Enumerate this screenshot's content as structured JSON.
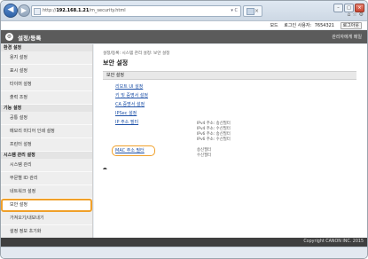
{
  "browser": {
    "url_prefix": "http://",
    "url_host": "192.168.1.21",
    "url_path": "/m_security.html",
    "url_controls": "▾ C",
    "tab_close": "×",
    "win_min": "–",
    "win_max": "□",
    "win_close": "×",
    "toolbar_icons": "⌂ ☆ ⚙"
  },
  "topbar": {
    "mode": "모드",
    "login_user_label": "로그인 사용자:",
    "login_user_value": "7654321",
    "logout": "로그아웃"
  },
  "header": {
    "logo": "⚙",
    "title": "설정/등록",
    "portal": "관리자에게 메일"
  },
  "sidebar": {
    "sections": [
      {
        "label": "환경 설정",
        "items": [
          "용지 설정",
          "표시 설정",
          "타이머 설정",
          "출력 조정"
        ]
      },
      {
        "label": "기능 설정",
        "items": [
          "공통 설정",
          "메모리 미디어 인쇄 설정",
          "프린터 설정"
        ]
      },
      {
        "label": "시스템 관리 설정",
        "items": [
          "시스템 관리",
          "부문별 ID 관리",
          "네트워크 설정",
          "보안 설정",
          "가져오기/내보내기",
          "설정 정보 초기화"
        ]
      }
    ]
  },
  "main": {
    "breadcrumb": "설정/등록: 시스템 관리 설정: 보안 설정",
    "title": "보안 설정",
    "panel_header": "보안 설정",
    "links": [
      "리모트 UI 설정",
      "키 및 증명서 설정",
      "CA 증명서 설정",
      "IPSec 설정",
      "IP 주소 필터",
      "MAC 주소 필터"
    ],
    "ip_filter_status": [
      "IPv4 주소: 송신필터",
      "IPv4 주소: 수신필터",
      "IPv6 주소: 송신필터",
      "IPv6 주소: 수신필터"
    ],
    "mac_filter_status": [
      "송신필터",
      "수신필터"
    ],
    "to_top": "⯊"
  },
  "footer": {
    "copyright": "Copyright CANON INC. 2015"
  },
  "statusbar": {
    "zoom": ""
  },
  "colors": {
    "highlight": "#f0a02a",
    "header_bg": "#5b5b5b",
    "link": "#1f52a8"
  }
}
